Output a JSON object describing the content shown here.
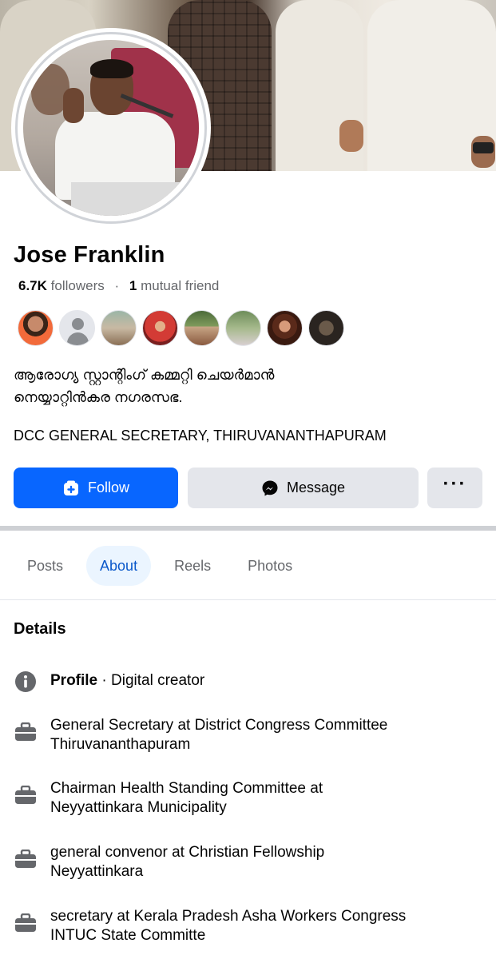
{
  "profile": {
    "name": "Jose Franklin",
    "followers_count": "6.7K",
    "followers_label": "followers",
    "separator": "·",
    "mutual_count": "1",
    "mutual_label": "mutual friend",
    "bio_line1": "ആരോഗ്യ സ്റ്റാന്റിംഗ് കമ്മറ്റി ചെയർമാൻ",
    "bio_line2": "നെയ്യാറ്റിൻകര നഗരസഭ.",
    "bio_line3": "DCC GENERAL SECRETARY, THIRUVANANTHAPURAM"
  },
  "actions": {
    "follow_label": "Follow",
    "message_label": "Message",
    "more_label": "···"
  },
  "tabs": [
    {
      "label": "Posts",
      "active": false
    },
    {
      "label": "About",
      "active": true
    },
    {
      "label": "Reels",
      "active": false
    },
    {
      "label": "Photos",
      "active": false
    }
  ],
  "details": {
    "title": "Details",
    "profile_label": "Profile",
    "profile_sep": " · ",
    "profile_value": "Digital creator",
    "items": [
      {
        "line1": "General Secretary at District Congress Committee",
        "line2": "Thiruvananthapuram"
      },
      {
        "line1": "Chairman Health Standing Committee at",
        "line2": "Neyyattinkara Municipality"
      },
      {
        "line1": "general convenor at Christian Fellowship",
        "line2": "Neyyattinkara"
      },
      {
        "line1": "secretary at Kerala Pradesh Asha Workers Congress",
        "line2": "INTUC State Committe"
      }
    ]
  },
  "colors": {
    "accent": "#0866ff",
    "tab_active_bg": "#ebf5ff",
    "tab_active_text": "#0a58ca",
    "muted": "#65676b"
  }
}
